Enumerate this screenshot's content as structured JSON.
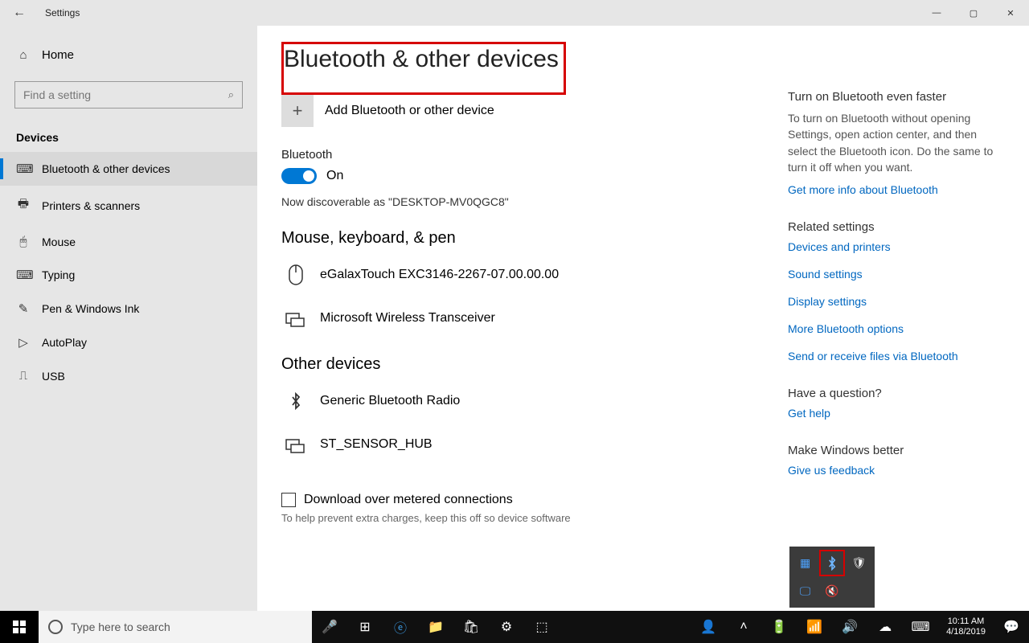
{
  "window": {
    "title": "Settings",
    "controls": {
      "minimize": "—",
      "maximize": "▢",
      "close": "✕"
    }
  },
  "sidebar": {
    "home": "Home",
    "search_placeholder": "Find a setting",
    "section": "Devices",
    "items": [
      {
        "label": "Bluetooth & other devices",
        "icon": "keyboard",
        "active": true
      },
      {
        "label": "Printers & scanners",
        "icon": "printer",
        "active": false
      },
      {
        "label": "Mouse",
        "icon": "mouse",
        "active": false
      },
      {
        "label": "Typing",
        "icon": "keyboard2",
        "active": false
      },
      {
        "label": "Pen & Windows Ink",
        "icon": "pen",
        "active": false
      },
      {
        "label": "AutoPlay",
        "icon": "autoplay",
        "active": false
      },
      {
        "label": "USB",
        "icon": "usb",
        "active": false
      }
    ]
  },
  "page": {
    "title": "Bluetooth & other devices",
    "add_label": "Add Bluetooth or other device",
    "bt_heading": "Bluetooth",
    "bt_state": "On",
    "discoverable": "Now discoverable as \"DESKTOP-MV0QGC8\"",
    "group1_title": "Mouse, keyboard, & pen",
    "group1": [
      {
        "name": "eGalaxTouch EXC3146-2267-07.00.00.00",
        "icon": "mouse"
      },
      {
        "name": "Microsoft Wireless Transceiver",
        "icon": "transceiver"
      }
    ],
    "group2_title": "Other devices",
    "group2": [
      {
        "name": "Generic Bluetooth Radio",
        "icon": "bluetooth"
      },
      {
        "name": "ST_SENSOR_HUB",
        "icon": "transceiver"
      }
    ],
    "metered_label": "Download over metered connections",
    "metered_help": "To help prevent extra charges, keep this off so device software"
  },
  "right": {
    "tip_title": "Turn on Bluetooth even faster",
    "tip_body": "To turn on Bluetooth without opening Settings, open action center, and then select the Bluetooth icon. Do the same to turn it off when you want.",
    "tip_link": "Get more info about Bluetooth",
    "related_title": "Related settings",
    "related_links": [
      "Devices and printers",
      "Sound settings",
      "Display settings",
      "More Bluetooth options",
      "Send or receive files via Bluetooth"
    ],
    "question_title": "Have a question?",
    "question_link": "Get help",
    "feedback_title": "Make Windows better",
    "feedback_link": "Give us feedback"
  },
  "taskbar": {
    "search_placeholder": "Type here to search",
    "time": "10:11 AM",
    "date": "4/18/2019"
  }
}
